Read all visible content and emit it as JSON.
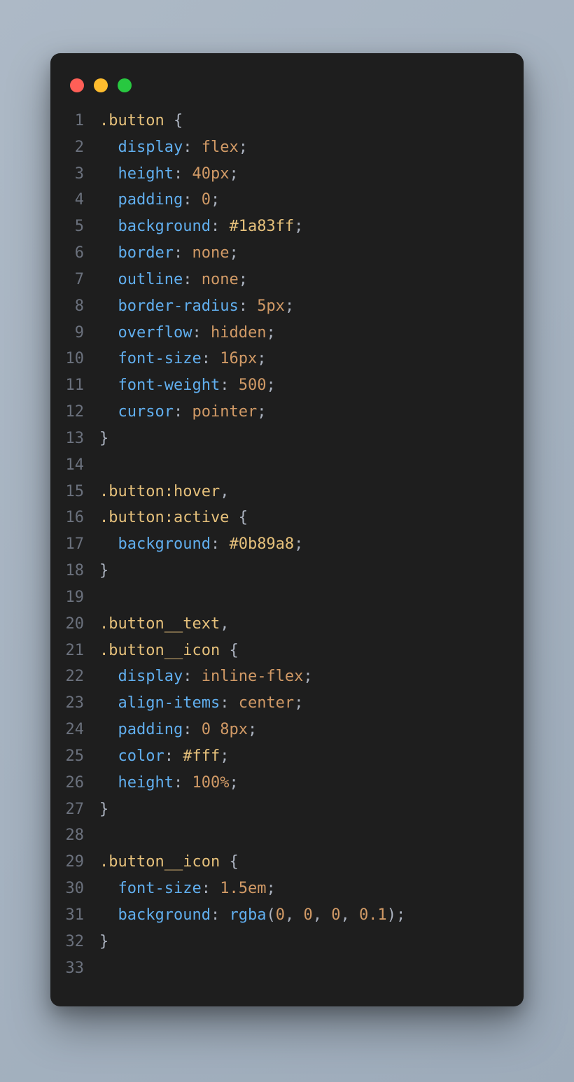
{
  "window": {
    "traffic_lights": [
      "close",
      "minimize",
      "zoom"
    ]
  },
  "code": {
    "language": "css",
    "lines": [
      {
        "n": "1",
        "tokens": [
          {
            "t": ".button ",
            "c": "sel"
          },
          {
            "t": "{",
            "c": "brace"
          }
        ]
      },
      {
        "n": "2",
        "tokens": [
          {
            "t": "  ",
            "c": "p"
          },
          {
            "t": "display",
            "c": "prop"
          },
          {
            "t": ": ",
            "c": "p"
          },
          {
            "t": "flex",
            "c": "val"
          },
          {
            "t": ";",
            "c": "p"
          }
        ]
      },
      {
        "n": "3",
        "tokens": [
          {
            "t": "  ",
            "c": "p"
          },
          {
            "t": "height",
            "c": "prop"
          },
          {
            "t": ": ",
            "c": "p"
          },
          {
            "t": "40px",
            "c": "num"
          },
          {
            "t": ";",
            "c": "p"
          }
        ]
      },
      {
        "n": "4",
        "tokens": [
          {
            "t": "  ",
            "c": "p"
          },
          {
            "t": "padding",
            "c": "prop"
          },
          {
            "t": ": ",
            "c": "p"
          },
          {
            "t": "0",
            "c": "num"
          },
          {
            "t": ";",
            "c": "p"
          }
        ]
      },
      {
        "n": "5",
        "tokens": [
          {
            "t": "  ",
            "c": "p"
          },
          {
            "t": "background",
            "c": "prop"
          },
          {
            "t": ": ",
            "c": "p"
          },
          {
            "t": "#1a83ff",
            "c": "hex"
          },
          {
            "t": ";",
            "c": "p"
          }
        ]
      },
      {
        "n": "6",
        "tokens": [
          {
            "t": "  ",
            "c": "p"
          },
          {
            "t": "border",
            "c": "prop"
          },
          {
            "t": ": ",
            "c": "p"
          },
          {
            "t": "none",
            "c": "val"
          },
          {
            "t": ";",
            "c": "p"
          }
        ]
      },
      {
        "n": "7",
        "tokens": [
          {
            "t": "  ",
            "c": "p"
          },
          {
            "t": "outline",
            "c": "prop"
          },
          {
            "t": ": ",
            "c": "p"
          },
          {
            "t": "none",
            "c": "val"
          },
          {
            "t": ";",
            "c": "p"
          }
        ]
      },
      {
        "n": "8",
        "tokens": [
          {
            "t": "  ",
            "c": "p"
          },
          {
            "t": "border-radius",
            "c": "prop"
          },
          {
            "t": ": ",
            "c": "p"
          },
          {
            "t": "5px",
            "c": "num"
          },
          {
            "t": ";",
            "c": "p"
          }
        ]
      },
      {
        "n": "9",
        "tokens": [
          {
            "t": "  ",
            "c": "p"
          },
          {
            "t": "overflow",
            "c": "prop"
          },
          {
            "t": ": ",
            "c": "p"
          },
          {
            "t": "hidden",
            "c": "val"
          },
          {
            "t": ";",
            "c": "p"
          }
        ]
      },
      {
        "n": "10",
        "tokens": [
          {
            "t": "  ",
            "c": "p"
          },
          {
            "t": "font-size",
            "c": "prop"
          },
          {
            "t": ": ",
            "c": "p"
          },
          {
            "t": "16px",
            "c": "num"
          },
          {
            "t": ";",
            "c": "p"
          }
        ]
      },
      {
        "n": "11",
        "tokens": [
          {
            "t": "  ",
            "c": "p"
          },
          {
            "t": "font-weight",
            "c": "prop"
          },
          {
            "t": ": ",
            "c": "p"
          },
          {
            "t": "500",
            "c": "num"
          },
          {
            "t": ";",
            "c": "p"
          }
        ]
      },
      {
        "n": "12",
        "tokens": [
          {
            "t": "  ",
            "c": "p"
          },
          {
            "t": "cursor",
            "c": "prop"
          },
          {
            "t": ": ",
            "c": "p"
          },
          {
            "t": "pointer",
            "c": "val"
          },
          {
            "t": ";",
            "c": "p"
          }
        ]
      },
      {
        "n": "13",
        "tokens": [
          {
            "t": "}",
            "c": "brace"
          }
        ]
      },
      {
        "n": "14",
        "tokens": [
          {
            "t": " ",
            "c": "p"
          }
        ]
      },
      {
        "n": "15",
        "tokens": [
          {
            "t": ".button:hover",
            "c": "sel"
          },
          {
            "t": ",",
            "c": "p"
          }
        ]
      },
      {
        "n": "16",
        "tokens": [
          {
            "t": ".button:active ",
            "c": "sel"
          },
          {
            "t": "{",
            "c": "brace"
          }
        ]
      },
      {
        "n": "17",
        "tokens": [
          {
            "t": "  ",
            "c": "p"
          },
          {
            "t": "background",
            "c": "prop"
          },
          {
            "t": ": ",
            "c": "p"
          },
          {
            "t": "#0b89a8",
            "c": "hex"
          },
          {
            "t": ";",
            "c": "p"
          }
        ]
      },
      {
        "n": "18",
        "tokens": [
          {
            "t": "}",
            "c": "brace"
          }
        ]
      },
      {
        "n": "19",
        "tokens": [
          {
            "t": " ",
            "c": "p"
          }
        ]
      },
      {
        "n": "20",
        "tokens": [
          {
            "t": ".button__text",
            "c": "sel"
          },
          {
            "t": ",",
            "c": "p"
          }
        ]
      },
      {
        "n": "21",
        "tokens": [
          {
            "t": ".button__icon ",
            "c": "sel"
          },
          {
            "t": "{",
            "c": "brace"
          }
        ]
      },
      {
        "n": "22",
        "tokens": [
          {
            "t": "  ",
            "c": "p"
          },
          {
            "t": "display",
            "c": "prop"
          },
          {
            "t": ": ",
            "c": "p"
          },
          {
            "t": "inline-flex",
            "c": "val"
          },
          {
            "t": ";",
            "c": "p"
          }
        ]
      },
      {
        "n": "23",
        "tokens": [
          {
            "t": "  ",
            "c": "p"
          },
          {
            "t": "align-items",
            "c": "prop"
          },
          {
            "t": ": ",
            "c": "p"
          },
          {
            "t": "center",
            "c": "val"
          },
          {
            "t": ";",
            "c": "p"
          }
        ]
      },
      {
        "n": "24",
        "tokens": [
          {
            "t": "  ",
            "c": "p"
          },
          {
            "t": "padding",
            "c": "prop"
          },
          {
            "t": ": ",
            "c": "p"
          },
          {
            "t": "0",
            "c": "num"
          },
          {
            "t": " ",
            "c": "p"
          },
          {
            "t": "8px",
            "c": "num"
          },
          {
            "t": ";",
            "c": "p"
          }
        ]
      },
      {
        "n": "25",
        "tokens": [
          {
            "t": "  ",
            "c": "p"
          },
          {
            "t": "color",
            "c": "prop"
          },
          {
            "t": ": ",
            "c": "p"
          },
          {
            "t": "#fff",
            "c": "hex"
          },
          {
            "t": ";",
            "c": "p"
          }
        ]
      },
      {
        "n": "26",
        "tokens": [
          {
            "t": "  ",
            "c": "p"
          },
          {
            "t": "height",
            "c": "prop"
          },
          {
            "t": ": ",
            "c": "p"
          },
          {
            "t": "100%",
            "c": "num"
          },
          {
            "t": ";",
            "c": "p"
          }
        ]
      },
      {
        "n": "27",
        "tokens": [
          {
            "t": "}",
            "c": "brace"
          }
        ]
      },
      {
        "n": "28",
        "tokens": [
          {
            "t": " ",
            "c": "p"
          }
        ]
      },
      {
        "n": "29",
        "tokens": [
          {
            "t": ".button__icon ",
            "c": "sel"
          },
          {
            "t": "{",
            "c": "brace"
          }
        ]
      },
      {
        "n": "30",
        "tokens": [
          {
            "t": "  ",
            "c": "p"
          },
          {
            "t": "font-size",
            "c": "prop"
          },
          {
            "t": ": ",
            "c": "p"
          },
          {
            "t": "1.5em",
            "c": "num"
          },
          {
            "t": ";",
            "c": "p"
          }
        ]
      },
      {
        "n": "31",
        "tokens": [
          {
            "t": "  ",
            "c": "p"
          },
          {
            "t": "background",
            "c": "prop"
          },
          {
            "t": ": ",
            "c": "p"
          },
          {
            "t": "rgba",
            "c": "fn"
          },
          {
            "t": "(",
            "c": "p"
          },
          {
            "t": "0",
            "c": "num"
          },
          {
            "t": ", ",
            "c": "p"
          },
          {
            "t": "0",
            "c": "num"
          },
          {
            "t": ", ",
            "c": "p"
          },
          {
            "t": "0",
            "c": "num"
          },
          {
            "t": ", ",
            "c": "p"
          },
          {
            "t": "0.1",
            "c": "num"
          },
          {
            "t": ")",
            "c": "p"
          },
          {
            "t": ";",
            "c": "p"
          }
        ]
      },
      {
        "n": "32",
        "tokens": [
          {
            "t": "}",
            "c": "brace"
          }
        ]
      },
      {
        "n": "33",
        "tokens": [
          {
            "t": " ",
            "c": "p"
          }
        ]
      }
    ]
  }
}
